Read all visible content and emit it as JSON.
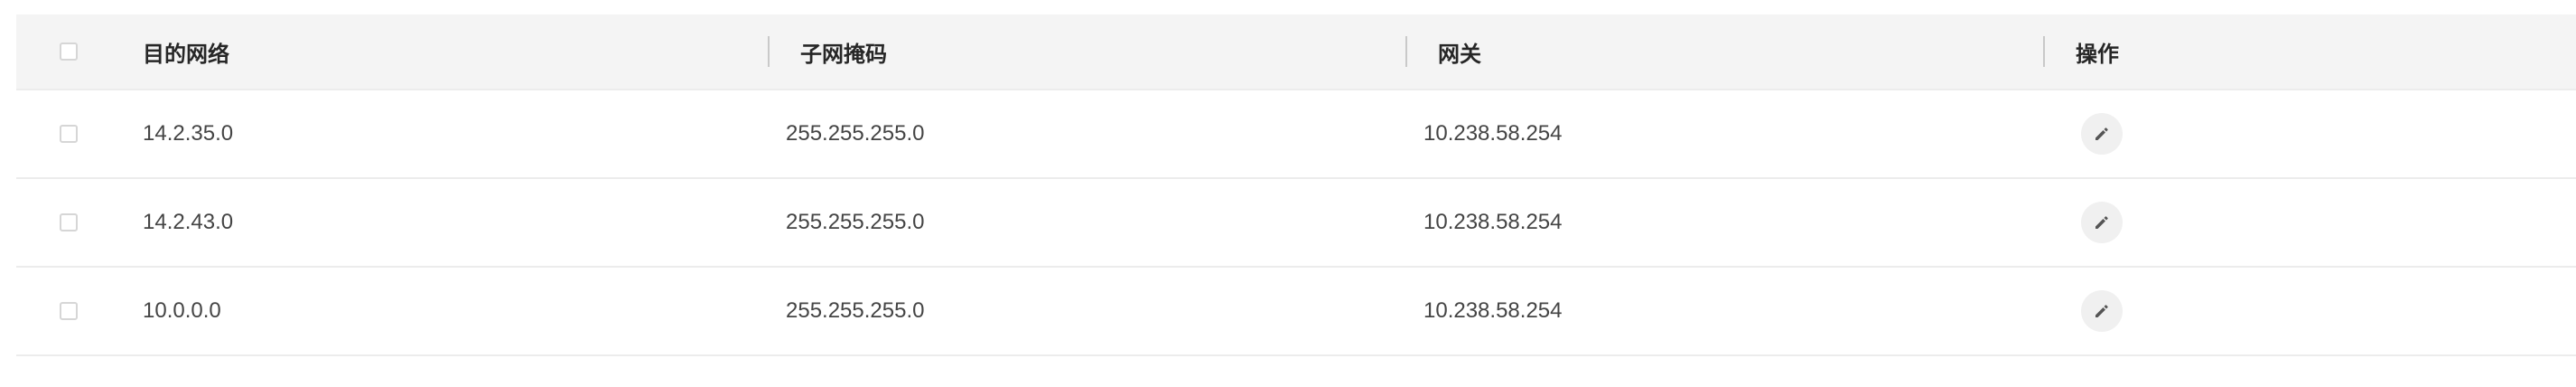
{
  "table": {
    "headers": {
      "select_all": "",
      "destination": "目的网络",
      "subnet_mask": "子网掩码",
      "gateway": "网关",
      "actions": "操作"
    },
    "rows": [
      {
        "destination": "14.2.35.0",
        "subnet_mask": "255.255.255.0",
        "gateway": "10.238.58.254",
        "action_icon": "pencil-icon"
      },
      {
        "destination": "14.2.43.0",
        "subnet_mask": "255.255.255.0",
        "gateway": "10.238.58.254",
        "action_icon": "pencil-icon"
      },
      {
        "destination": "10.0.0.0",
        "subnet_mask": "255.255.255.0",
        "gateway": "10.238.58.254",
        "action_icon": "pencil-icon"
      }
    ]
  },
  "colors": {
    "header_bg": "#f4f4f4",
    "row_border": "#ececec",
    "icon_button_bg": "#f0f0f0",
    "icon_color": "#555555"
  }
}
